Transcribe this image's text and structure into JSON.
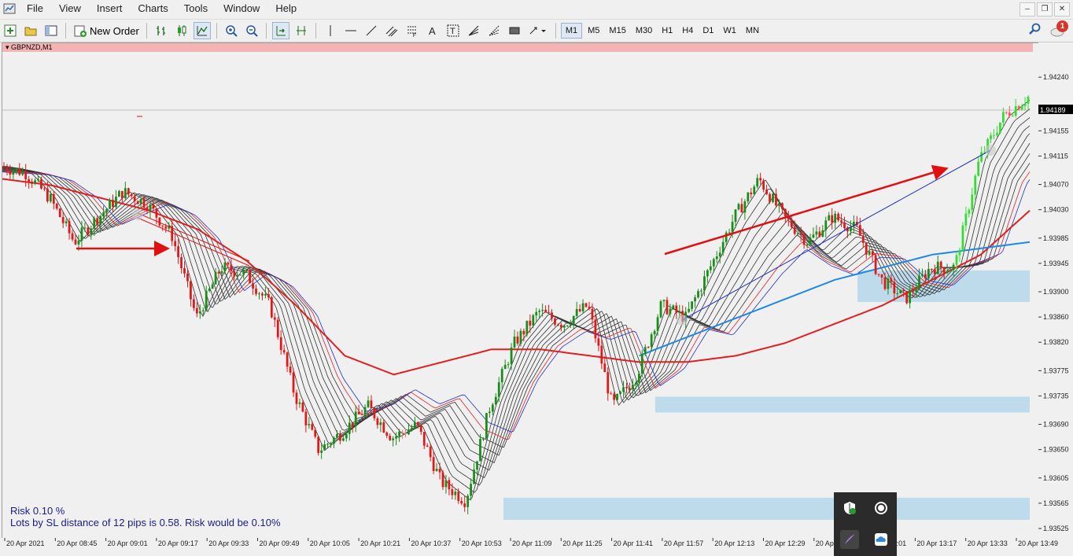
{
  "menu": {
    "items": [
      "File",
      "View",
      "Insert",
      "Charts",
      "Tools",
      "Window",
      "Help"
    ]
  },
  "toolbar": {
    "new_order_label": "New Order",
    "timeframes": [
      "M1",
      "M5",
      "M15",
      "M30",
      "H1",
      "H4",
      "D1",
      "W1",
      "MN"
    ],
    "active_timeframe": "M1"
  },
  "notification_count": "1",
  "chart_window": {
    "symbol_title": "GBPNZD,M1",
    "risk_line1": "Risk 0.10 %",
    "risk_line2": "Lots by SL distance of 12 pips is 0.58. Risk would be 0.10%"
  },
  "colors": {
    "bull": "#1a8c1a",
    "bear": "#e01818",
    "slow_ma": "#e02020",
    "blue_ma": "#1e88e5",
    "zone": "#bddbea",
    "title_bar": "#f4b4b4"
  },
  "chart_data": {
    "type": "candlestick",
    "title": "GBPNZD,M1",
    "ylim": [
      1.9352,
      1.9428
    ],
    "y_ticks": [
      "1.94240",
      "1.94155",
      "1.94115",
      "1.94070",
      "1.94030",
      "1.93985",
      "1.93945",
      "1.93900",
      "1.93860",
      "1.93820",
      "1.93775",
      "1.93735",
      "1.93690",
      "1.93650",
      "1.93605",
      "1.93565",
      "1.93525"
    ],
    "current_price": "1.94189",
    "x_ticks": [
      "20 Apr 2021",
      "20 Apr 08:45",
      "20 Apr 09:01",
      "20 Apr 09:17",
      "20 Apr 09:33",
      "20 Apr 09:49",
      "20 Apr 10:05",
      "20 Apr 10:21",
      "20 Apr 10:37",
      "20 Apr 10:53",
      "20 Apr 11:09",
      "20 Apr 11:25",
      "20 Apr 11:41",
      "20 Apr 11:57",
      "20 Apr 12:13",
      "20 Apr 12:29",
      "20 Apr 12:45",
      "20 Apr 13:01",
      "20 Apr 13:17",
      "20 Apr 13:33",
      "20 Apr 13:49"
    ],
    "price_path": [
      1.941,
      1.9409,
      1.9405,
      1.9398,
      1.9402,
      1.9406,
      1.9404,
      1.9399,
      1.9386,
      1.9394,
      1.9393,
      1.9388,
      1.9374,
      1.9365,
      1.9368,
      1.9372,
      1.9367,
      1.9369,
      1.936,
      1.9357,
      1.9372,
      1.9382,
      1.9387,
      1.9385,
      1.9388,
      1.9372,
      1.9377,
      1.9388,
      1.9386,
      1.9394,
      1.9402,
      1.9408,
      1.9402,
      1.9398,
      1.9402,
      1.94,
      1.9392,
      1.9389,
      1.9394,
      1.9394,
      1.9411,
      1.9418,
      1.9421
    ],
    "slow_ma": [
      1.9408,
      1.9407,
      1.9405,
      1.9403,
      1.94,
      1.9395,
      1.9388,
      1.938,
      1.9377,
      1.9379,
      1.9381,
      1.9381,
      1.938,
      1.9379,
      1.9379,
      1.938,
      1.9382,
      1.9385,
      1.9388,
      1.9392,
      1.9396,
      1.9403
    ],
    "blue_ma": [
      1.938,
      1.9386,
      1.9392,
      1.9396,
      1.9398
    ],
    "zones": [
      {
        "from": "20 Apr 13:01",
        "to": "20 Apr 13:49",
        "low": 1.93885,
        "high": 1.93935
      },
      {
        "from": "20 Apr 11:57",
        "to": "20 Apr 13:49",
        "low": 1.9371,
        "high": 1.93735
      },
      {
        "from": "20 Apr 11:09",
        "to": "20 Apr 13:49",
        "low": 1.9354,
        "high": 1.93575
      }
    ]
  }
}
